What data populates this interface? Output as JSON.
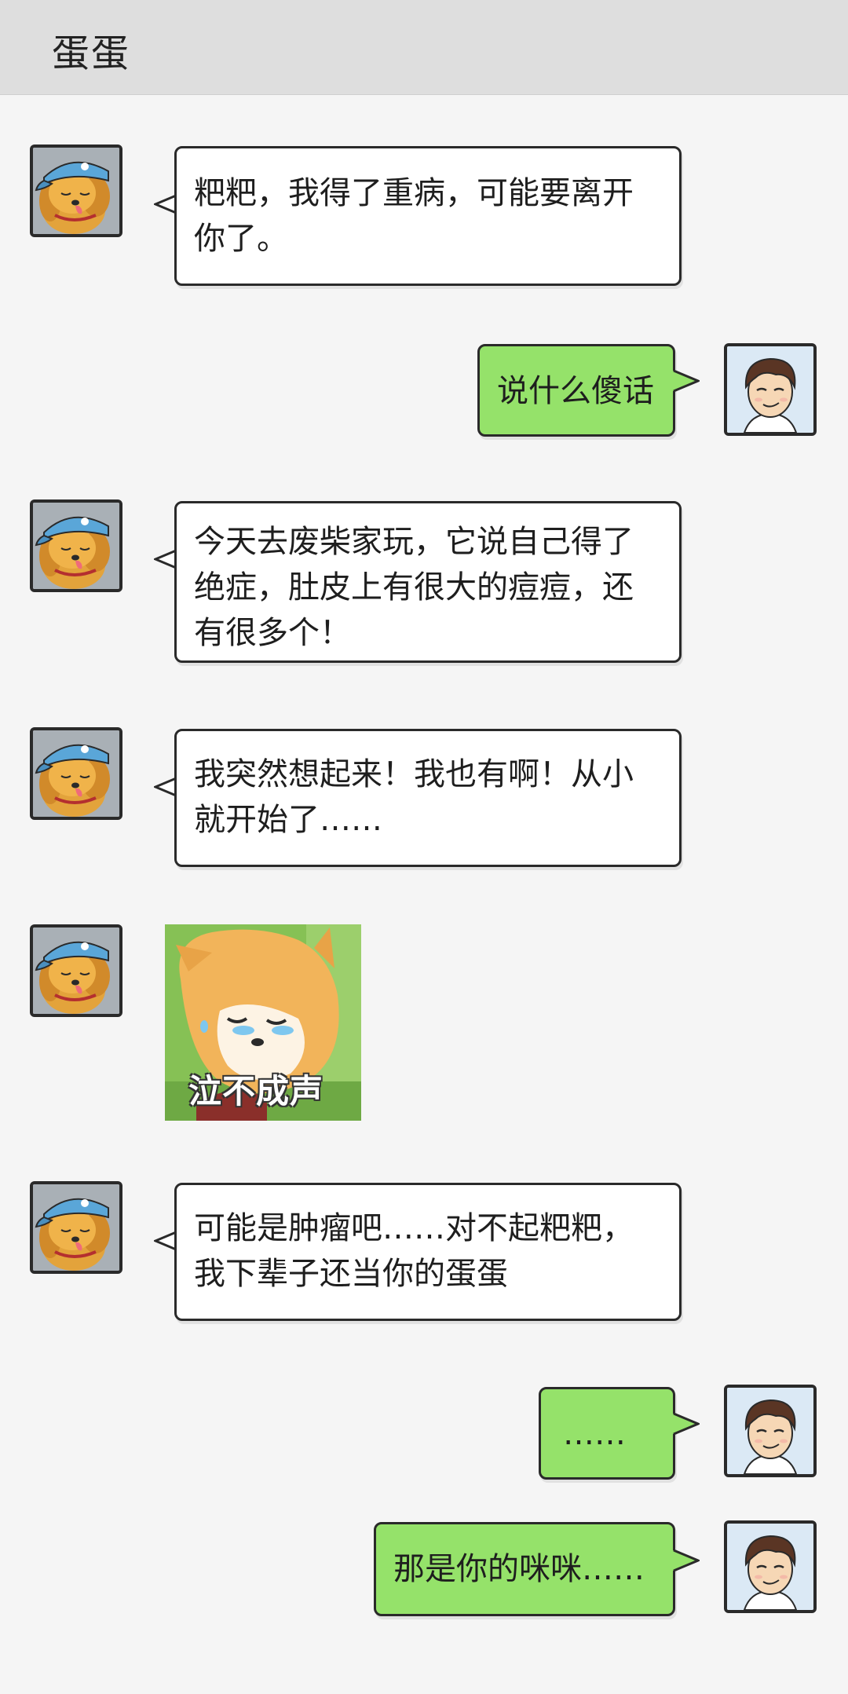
{
  "header": {
    "title": "蛋蛋"
  },
  "messages": [
    {
      "sender": "dog",
      "text_lines": [
        "粑粑，我得了重病，可能要离开",
        "你了。"
      ]
    },
    {
      "sender": "boy",
      "text_lines": [
        "说什么傻话"
      ]
    },
    {
      "sender": "dog",
      "text_lines": [
        "今天去废柴家玩，它说自己得了",
        "绝症，肚皮上有很大的痘痘，还",
        "有很多个！"
      ]
    },
    {
      "sender": "dog",
      "text_lines": [
        "我突然想起来！我也有啊！从小",
        "就开始了……"
      ]
    },
    {
      "sender": "dog",
      "sticker": {
        "caption": "泣不成声",
        "icon": "crying-shiba-sticker"
      }
    },
    {
      "sender": "dog",
      "text_lines": [
        "可能是肿瘤吧……对不起粑粑，",
        "我下辈子还当你的蛋蛋"
      ]
    },
    {
      "sender": "boy",
      "text_lines": [
        "……"
      ]
    },
    {
      "sender": "boy",
      "text_lines": [
        "那是你的咪咪……"
      ]
    }
  ],
  "colors": {
    "header_bg": "#dedede",
    "page_bg": "#f5f5f5",
    "incoming_bubble": "#ffffff",
    "outgoing_bubble": "#95e26a",
    "outline": "#2a2a2a"
  },
  "icons": {
    "dog_avatar": "golden-retriever-cap-avatar",
    "boy_avatar": "boy-avatar"
  }
}
